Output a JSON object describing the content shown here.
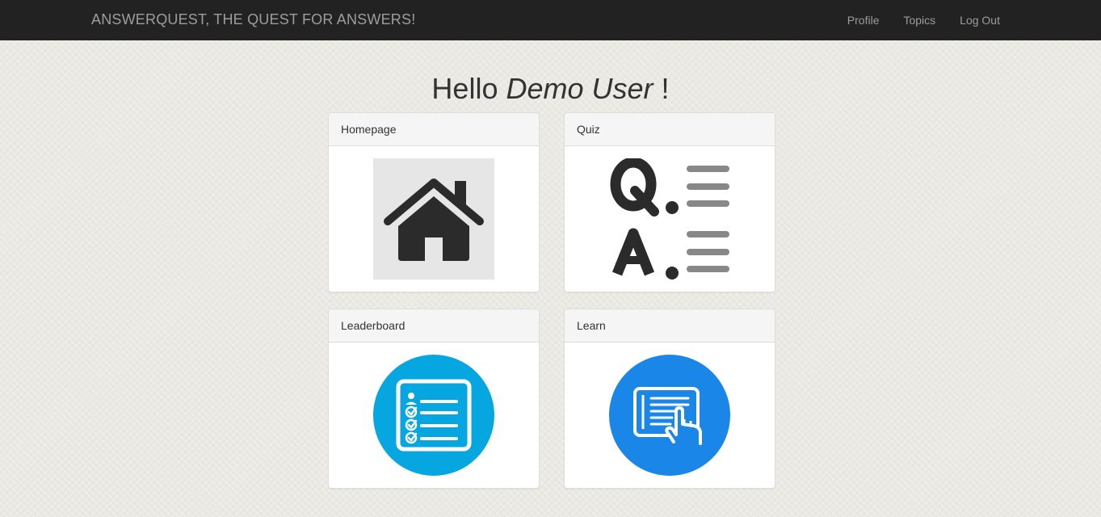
{
  "navbar": {
    "brand": "ANSWERQUEST, THE QUEST FOR ANSWERS!",
    "links": [
      {
        "label": "Profile"
      },
      {
        "label": "Topics"
      },
      {
        "label": "Log Out"
      }
    ]
  },
  "greeting": {
    "prefix": "Hello",
    "user_name": "Demo User",
    "suffix": "!"
  },
  "cards": [
    {
      "title": "Homepage",
      "icon": "house-icon"
    },
    {
      "title": "Quiz",
      "icon": "question-answer-icon"
    },
    {
      "title": "Leaderboard",
      "icon": "checklist-icon"
    },
    {
      "title": "Learn",
      "icon": "tablet-touch-icon"
    }
  ],
  "colors": {
    "navbar_bg": "#222222",
    "nav_text": "#9d9d9d",
    "leaderboard_circle": "#06a6e0",
    "learn_circle": "#1a86e8",
    "icon_dark": "#2b2b2b",
    "quiz_lines": "#888888"
  }
}
